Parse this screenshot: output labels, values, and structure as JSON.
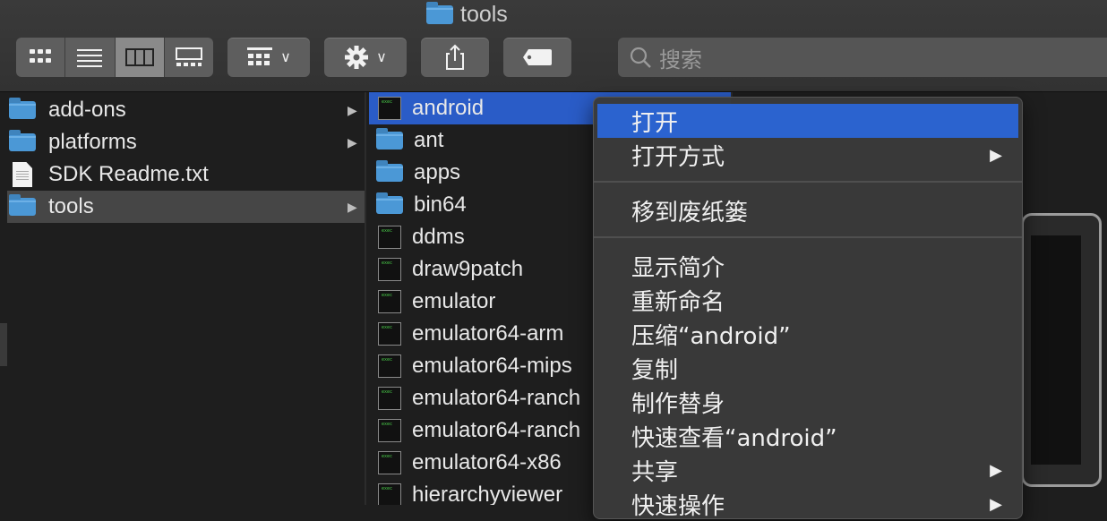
{
  "window": {
    "title": "tools"
  },
  "toolbar": {
    "view_modes": [
      "icon-view",
      "list-view",
      "column-view",
      "gallery-view"
    ],
    "active_view": "column-view",
    "search_placeholder": "搜索"
  },
  "column1": {
    "items": [
      {
        "label": "add-ons",
        "type": "folder",
        "has_children": true
      },
      {
        "label": "platforms",
        "type": "folder",
        "has_children": true
      },
      {
        "label": "SDK Readme.txt",
        "type": "document",
        "has_children": false
      },
      {
        "label": "tools",
        "type": "folder",
        "has_children": true,
        "selected": true
      }
    ]
  },
  "column2": {
    "items": [
      {
        "label": "android",
        "type": "exec",
        "selected": true
      },
      {
        "label": "ant",
        "type": "folder"
      },
      {
        "label": "apps",
        "type": "folder"
      },
      {
        "label": "bin64",
        "type": "folder"
      },
      {
        "label": "ddms",
        "type": "exec"
      },
      {
        "label": "draw9patch",
        "type": "exec"
      },
      {
        "label": "emulator",
        "type": "exec"
      },
      {
        "label": "emulator64-arm",
        "type": "exec"
      },
      {
        "label": "emulator64-mips",
        "type": "exec"
      },
      {
        "label": "emulator64-ranch",
        "type": "exec"
      },
      {
        "label": "emulator64-ranch",
        "type": "exec"
      },
      {
        "label": "emulator64-x86",
        "type": "exec"
      },
      {
        "label": "hierarchyviewer",
        "type": "exec"
      }
    ]
  },
  "context_menu": {
    "items": [
      {
        "label": "打开",
        "highlighted": true
      },
      {
        "label": "打开方式",
        "submenu": true
      },
      {
        "label": "移到废纸篓"
      },
      {
        "label": "显示简介"
      },
      {
        "label": "重新命名"
      },
      {
        "label": "压缩“android”"
      },
      {
        "label": "复制"
      },
      {
        "label": "制作替身"
      },
      {
        "label": "快速查看“android”"
      },
      {
        "label": "共享",
        "submenu": true
      },
      {
        "label": "快速操作",
        "submenu": true
      }
    ],
    "submenu_arrow": "▶"
  },
  "colors": {
    "selection_blue": "#2b63cf",
    "folder_blue": "#4b98d6",
    "toolbar_bg": "#3a3a3a",
    "window_bg": "#1e1e1e"
  }
}
